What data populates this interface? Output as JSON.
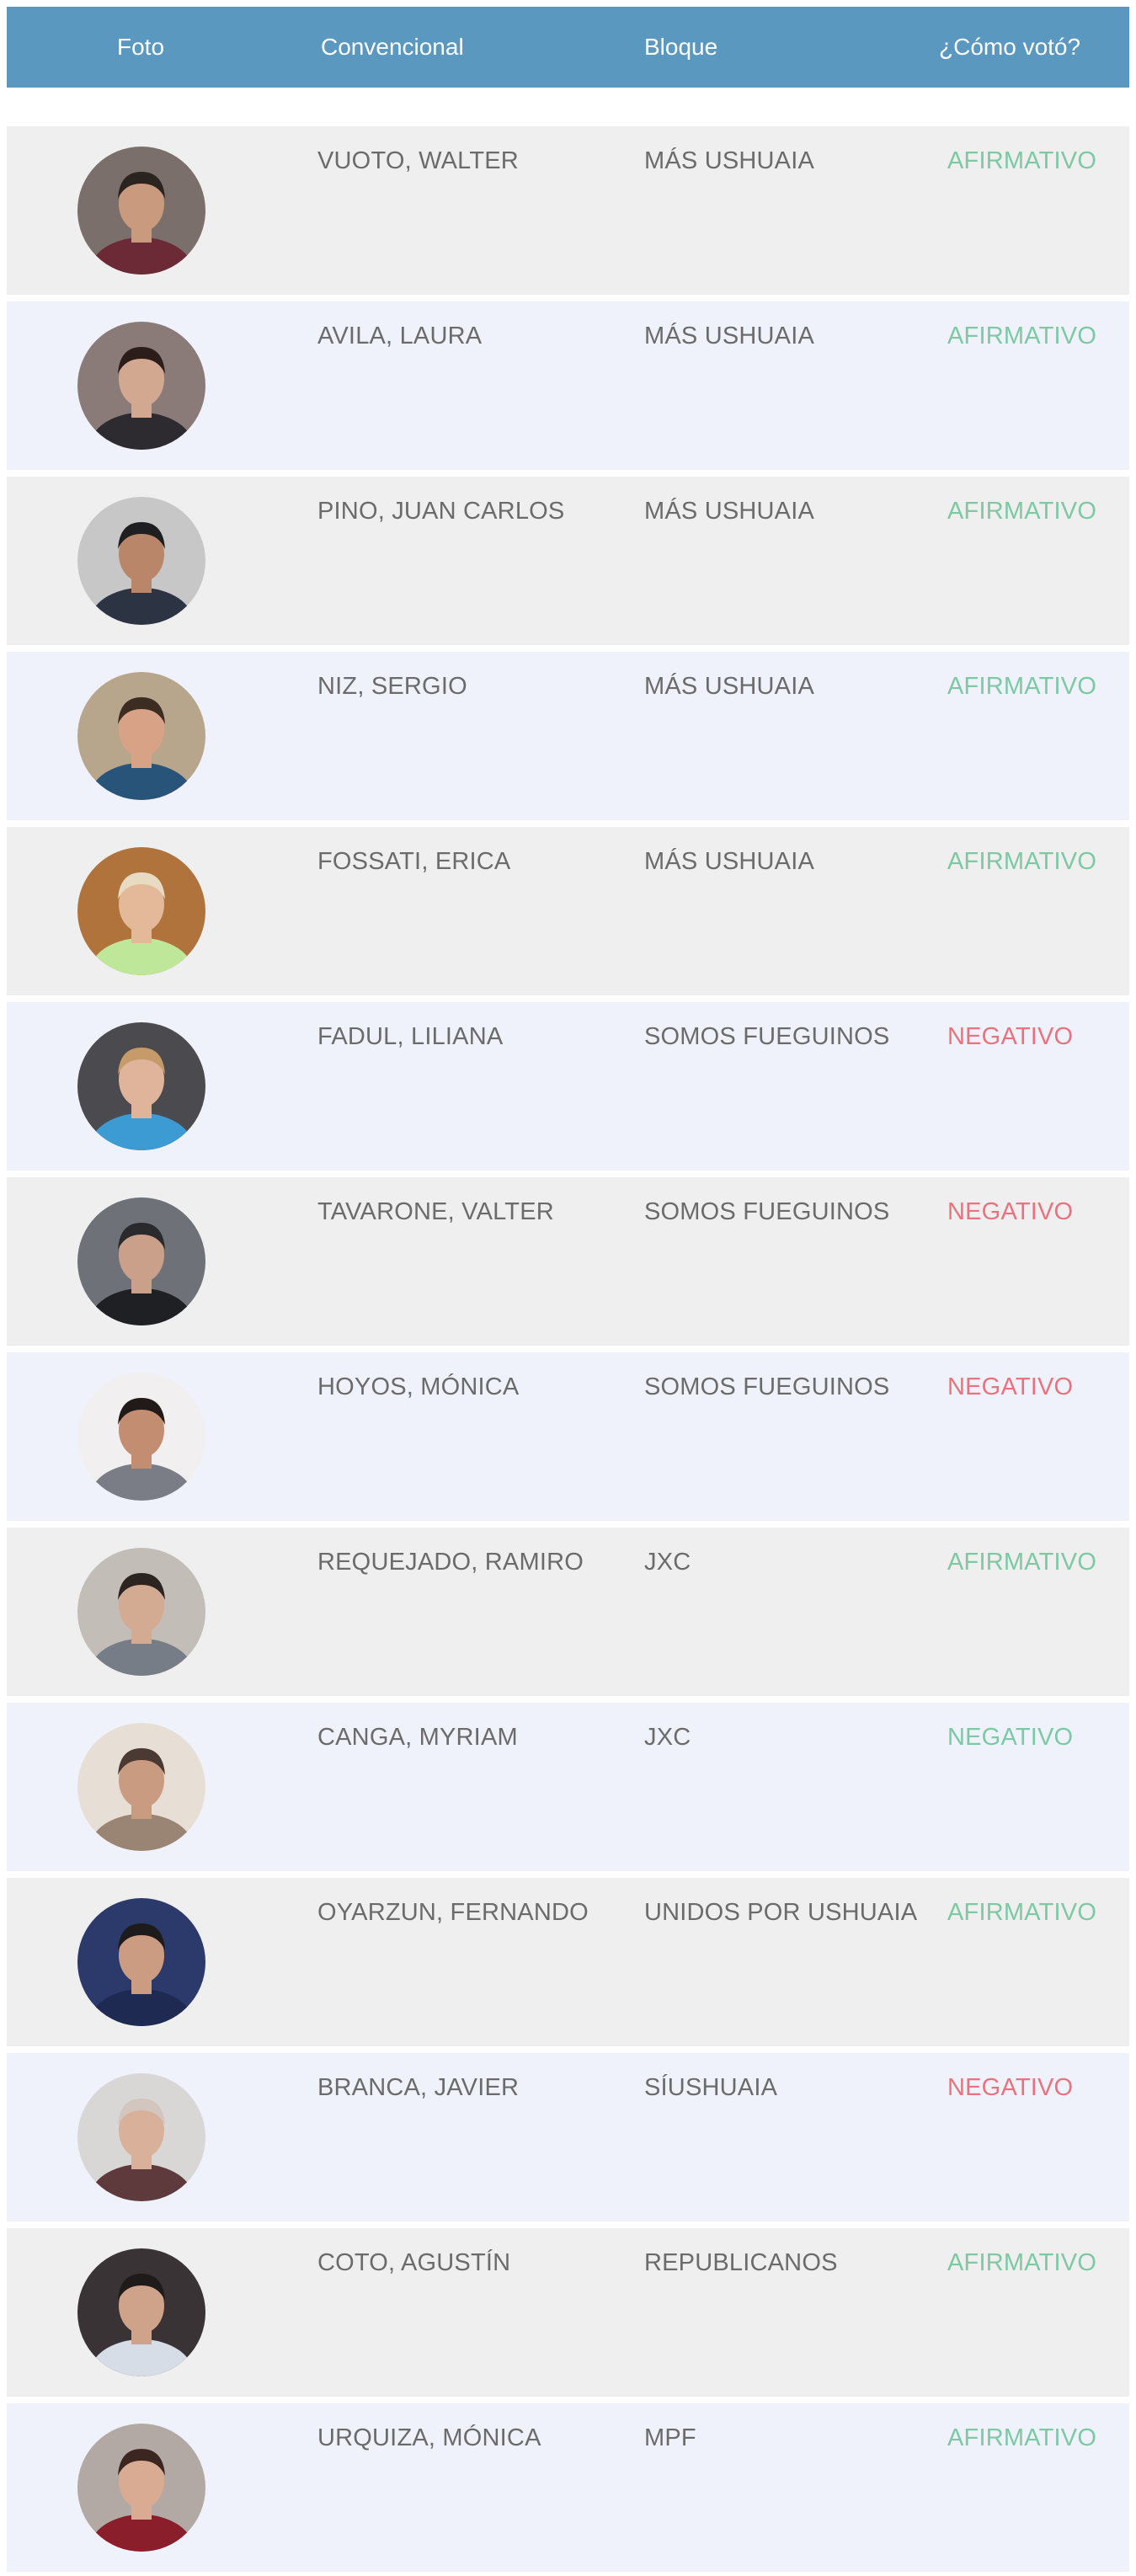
{
  "header": {
    "foto": "Foto",
    "convencional": "Convencional",
    "bloque": "Bloque",
    "vote": "¿Cómo votó?"
  },
  "colors": {
    "header_bg": "#5b98bf",
    "afirmativo": "#7cc9a3",
    "negativo": "#e8737f",
    "row_odd": "#efefef",
    "row_even": "#eff2fa"
  },
  "rows": [
    {
      "name": "VUOTO, WALTER",
      "bloque": "MÁS USHUAIA",
      "vote": "AFIRMATIVO",
      "vote_color": "#7cc9a3",
      "avatar": {
        "bg": "#7a6f6a",
        "skin": "#c99a7e",
        "hair": "#2a2320",
        "shirt": "#6b2a36"
      }
    },
    {
      "name": "AVILA, LAURA",
      "bloque": "MÁS USHUAIA",
      "vote": "AFIRMATIVO",
      "vote_color": "#7cc9a3",
      "avatar": {
        "bg": "#8a7a78",
        "skin": "#d3a890",
        "hair": "#2b1d1a",
        "shirt": "#2d2b30"
      }
    },
    {
      "name": "PINO, JUAN CARLOS",
      "bloque": "MÁS USHUAIA",
      "vote": "AFIRMATIVO",
      "vote_color": "#7cc9a3",
      "avatar": {
        "bg": "#c8c7c8",
        "skin": "#b9866a",
        "hair": "#1f1f22",
        "shirt": "#2c3444"
      }
    },
    {
      "name": "NIZ, SERGIO",
      "bloque": "MÁS USHUAIA",
      "vote": "AFIRMATIVO",
      "vote_color": "#7cc9a3",
      "avatar": {
        "bg": "#b7a68c",
        "skin": "#d8a286",
        "hair": "#3b2d22",
        "shirt": "#29547a"
      }
    },
    {
      "name": "FOSSATI, ERICA",
      "bloque": "MÁS USHUAIA",
      "vote": "AFIRMATIVO",
      "vote_color": "#7cc9a3",
      "avatar": {
        "bg": "#b0733c",
        "skin": "#e3b99a",
        "hair": "#e7dcc2",
        "shirt": "#bfe79a"
      }
    },
    {
      "name": "FADUL, LILIANA",
      "bloque": "SOMOS FUEGUINOS",
      "vote": "NEGATIVO",
      "vote_color": "#e8737f",
      "avatar": {
        "bg": "#4b4a4f",
        "skin": "#e0b49a",
        "hair": "#c79a6a",
        "shirt": "#3b9bd2"
      }
    },
    {
      "name": "TAVARONE, VALTER",
      "bloque": "SOMOS FUEGUINOS",
      "vote": "NEGATIVO",
      "vote_color": "#e8737f",
      "avatar": {
        "bg": "#6e7178",
        "skin": "#caa08a",
        "hair": "#2a2a2c",
        "shirt": "#1e2024"
      }
    },
    {
      "name": "HOYOS, MÓNICA",
      "bloque": "SOMOS FUEGUINOS",
      "vote": "NEGATIVO",
      "vote_color": "#e8737f",
      "avatar": {
        "bg": "#f1eff0",
        "skin": "#c38d72",
        "hair": "#211a18",
        "shirt": "#7a7d86"
      }
    },
    {
      "name": "REQUEJADO, RAMIRO",
      "bloque": "JXC",
      "vote": "AFIRMATIVO",
      "vote_color": "#7cc9a3",
      "avatar": {
        "bg": "#c2bdb6",
        "skin": "#d3aa92",
        "hair": "#2b2420",
        "shirt": "#777d86"
      }
    },
    {
      "name": "CANGA, MYRIAM",
      "bloque": "JXC",
      "vote": "NEGATIVO",
      "vote_color": "#7cc9a3",
      "avatar": {
        "bg": "#e7ded6",
        "skin": "#c99c82",
        "hair": "#4a3a33",
        "shirt": "#9a8474"
      }
    },
    {
      "name": "OYARZUN, FERNANDO",
      "bloque": "UNIDOS POR USHUAIA",
      "vote": "AFIRMATIVO",
      "vote_color": "#7cc9a3",
      "avatar": {
        "bg": "#2b3a6a",
        "skin": "#cc9c82",
        "hair": "#1d1b1c",
        "shirt": "#1e2a52"
      }
    },
    {
      "name": "BRANCA, JAVIER",
      "bloque": "SÍUSHUAIA",
      "vote": "NEGATIVO",
      "vote_color": "#e8737f",
      "avatar": {
        "bg": "#d9d7d6",
        "skin": "#d9b19b",
        "hair": "#d2c6bf",
        "shirt": "#5e3a3c"
      }
    },
    {
      "name": "COTO, AGUSTÍN",
      "bloque": "REPUBLICANOS",
      "vote": "AFIRMATIVO",
      "vote_color": "#7cc9a3",
      "avatar": {
        "bg": "#3a3336",
        "skin": "#cfa28a",
        "hair": "#1f1b1b",
        "shirt": "#d7dde6"
      }
    },
    {
      "name": "URQUIZA, MÓNICA",
      "bloque": "MPF",
      "vote": "AFIRMATIVO",
      "vote_color": "#7cc9a3",
      "avatar": {
        "bg": "#b3a9a4",
        "skin": "#d8ab92",
        "hair": "#3b2622",
        "shirt": "#8a1e2a"
      }
    }
  ]
}
